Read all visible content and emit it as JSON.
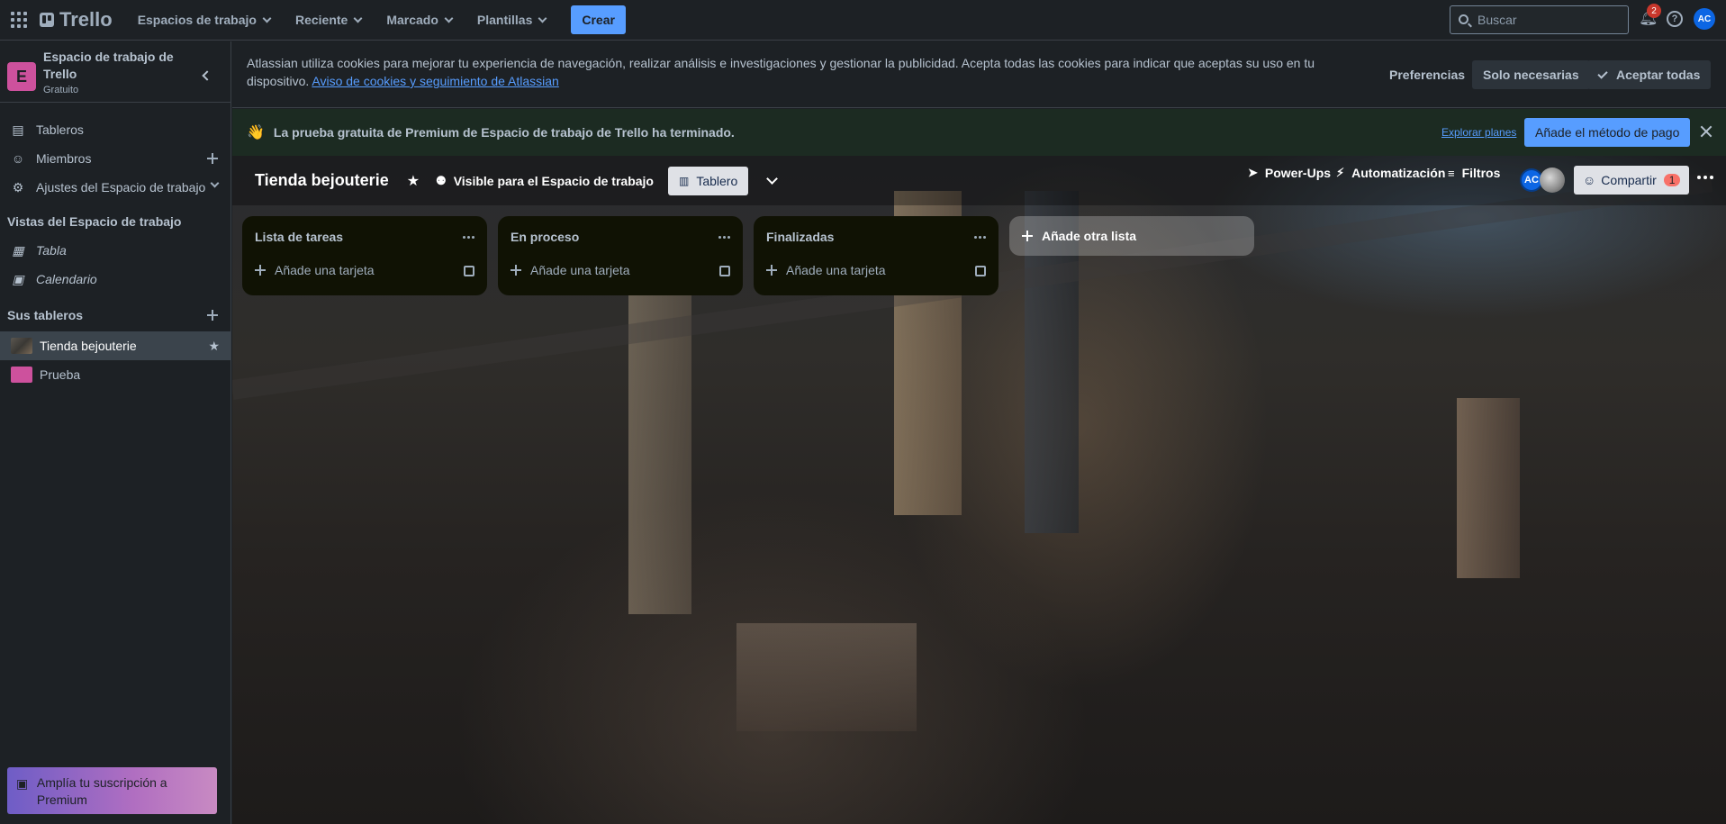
{
  "topbar": {
    "logo": "Trello",
    "nav": [
      {
        "label": "Espacios de trabajo"
      },
      {
        "label": "Reciente"
      },
      {
        "label": "Marcado"
      },
      {
        "label": "Plantillas"
      }
    ],
    "create_label": "Crear",
    "search_placeholder": "Buscar",
    "notifications_count": "2",
    "help_icon": "?",
    "avatar_initials": "AC"
  },
  "sidebar": {
    "workspace_initial": "E",
    "workspace_name": "Espacio de trabajo de Trello",
    "workspace_plan": "Gratuito",
    "items": [
      {
        "label": "Tableros"
      },
      {
        "label": "Miembros"
      },
      {
        "label": "Ajustes del Espacio de trabajo"
      }
    ],
    "views_title": "Vistas del Espacio de trabajo",
    "views": [
      {
        "label": "Tabla"
      },
      {
        "label": "Calendario"
      }
    ],
    "boards_title": "Sus tableros",
    "boards": [
      {
        "label": "Tienda bejouterie"
      },
      {
        "label": "Prueba"
      }
    ],
    "premium_label": "Amplía tu suscripción a Premium"
  },
  "cookie": {
    "text": "Atlassian utiliza cookies para mejorar tu experiencia de navegación, realizar análisis e investigaciones y gestionar la publicidad. Acepta todas las cookies para indicar que aceptas su uso en tu dispositivo. ",
    "link": "Aviso de cookies y seguimiento de Atlassian",
    "preferences": "Preferencias",
    "necessary": "Solo necesarias",
    "accept": "Aceptar todas"
  },
  "trial": {
    "icon": "👋",
    "text": "La prueba gratuita de Premium de Espacio de trabajo de Trello ha terminado.",
    "explore": "Explorar planes",
    "pay": "Añade el método de pago"
  },
  "board": {
    "title": "Tienda bejouterie",
    "visibility": "Visible para el Espacio de trabajo",
    "view": "Tablero",
    "powerups": "Power-Ups",
    "automation": "Automatización",
    "filters": "Filtros",
    "member_initials": "AC",
    "share": "Compartir",
    "share_count": "1",
    "lists": [
      {
        "title": "Lista de tareas",
        "add_card": "Añade una tarjeta"
      },
      {
        "title": "En proceso",
        "add_card": "Añade una tarjeta"
      },
      {
        "title": "Finalizadas",
        "add_card": "Añade una tarjeta"
      }
    ],
    "add_list": "Añade otra lista"
  },
  "colors": {
    "accent": "#579dff",
    "workspace": "#cd519d",
    "list_bg": "#101204"
  }
}
